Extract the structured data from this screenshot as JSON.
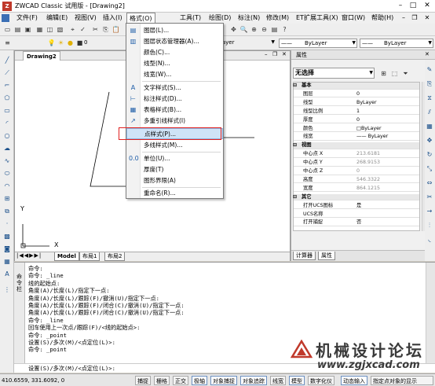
{
  "titlebar": {
    "logo": "Z",
    "title": "ZWCAD Classic 试用版 - [Drawing2]"
  },
  "menubar": {
    "items": [
      "文件(F)",
      "编辑(E)",
      "视图(V)",
      "插入(I)",
      "格式(O)",
      "工具(T)",
      "绘图(D)",
      "标注(N)",
      "修改(M)",
      "ET扩展工具(X)",
      "窗口(W)",
      "帮助(H)"
    ],
    "open_index": 4
  },
  "toolbar2": {
    "layer_value": "0",
    "color_value": "ByLayer",
    "linetype_value": "ByLayer",
    "lineweight_value": "ByLayer"
  },
  "drawing": {
    "tab": "Drawing2",
    "axis_y": "Y",
    "axis_x": "X",
    "layout_tabs": [
      "Model",
      "布局1",
      "布局2"
    ]
  },
  "format_menu": {
    "items": [
      {
        "label": "图层(L)...",
        "icon": "layer-icon"
      },
      {
        "label": "图层状态管理器(A)...",
        "icon": "layer-state-icon"
      },
      {
        "label": "颜色(C)...",
        "icon": ""
      },
      {
        "label": "线型(N)...",
        "icon": ""
      },
      {
        "label": "线宽(W)...",
        "icon": ""
      },
      {
        "label": "文字样式(S)...",
        "icon": "text-style-icon"
      },
      {
        "label": "标注样式(D)...",
        "icon": "dim-style-icon"
      },
      {
        "label": "表格样式(B)...",
        "icon": "table-style-icon"
      },
      {
        "label": "多重引线样式(I)",
        "icon": "mleader-style-icon"
      },
      {
        "label": "点样式(P)...",
        "icon": ""
      },
      {
        "label": "多线样式(M)...",
        "icon": ""
      },
      {
        "label": "单位(U)...",
        "icon": "units-icon"
      },
      {
        "label": "厚度(T)",
        "icon": ""
      },
      {
        "label": "图形界限(A)",
        "icon": ""
      },
      {
        "label": "重命名(R)...",
        "icon": ""
      }
    ],
    "highlight_index": 9
  },
  "properties": {
    "header": "属性",
    "selection": "无选择",
    "rows": [
      {
        "k": "基本",
        "cat": true
      },
      {
        "k": "图层",
        "v": "0"
      },
      {
        "k": "线型",
        "v": "ByLayer"
      },
      {
        "k": "线型比例",
        "v": "1"
      },
      {
        "k": "厚度",
        "v": "0"
      },
      {
        "k": "颜色",
        "v": "□ByLayer"
      },
      {
        "k": "线宽",
        "v": "—— ByLayer"
      },
      {
        "k": "视图",
        "cat": true
      },
      {
        "k": "中心点 X",
        "v": "213.6181",
        "gray": true
      },
      {
        "k": "中心点 Y",
        "v": "268.9153",
        "gray": true
      },
      {
        "k": "中心点 Z",
        "v": "0",
        "gray": true
      },
      {
        "k": "高度",
        "v": "546.3322",
        "gray": true
      },
      {
        "k": "宽度",
        "v": "864.1215",
        "gray": true
      },
      {
        "k": "其它",
        "cat": true
      },
      {
        "k": "打开UCS图标",
        "v": "是"
      },
      {
        "k": "UCS名称",
        "v": ""
      },
      {
        "k": "打开捕捉",
        "v": "否"
      }
    ],
    "bottom_tabs": [
      "计算器",
      "属性"
    ]
  },
  "command": {
    "side_label": "命令栏",
    "lines": [
      "命令:",
      "命令: _line",
      "线的起始点:",
      "角度(A)/长度(L)/指定下一点:",
      "角度(A)/长度(L)/跟踪(F)/撤消(U)/指定下一点:",
      "角度(A)/长度(L)/跟踪(F)/闭合(C)/撤消(U)/指定下一点:",
      "角度(A)/长度(L)/跟踪(F)/闭合(C)/撤消(U)/指定下一点:",
      "命令: _line",
      "回车使用上一次点/跟踪(F)/<线的起始点>:",
      "命令: _point",
      "设置(S)/多次(M)/<点定位(L)>:",
      "命令: _point"
    ],
    "input": "设置(S)/多次(M)/<点定位(L)>:"
  },
  "status": {
    "coords": "410.6559, 331.6092, 0",
    "buttons": [
      "捕捉",
      "栅格",
      "正交",
      "极轴",
      "对象捕捉",
      "对象追踪",
      "线宽",
      "模型",
      "数字化仪",
      "动态输入",
      "指定点对象的显示"
    ]
  },
  "watermark": {
    "text": "机械设计论坛",
    "url": "www.zgjxcad.com"
  }
}
